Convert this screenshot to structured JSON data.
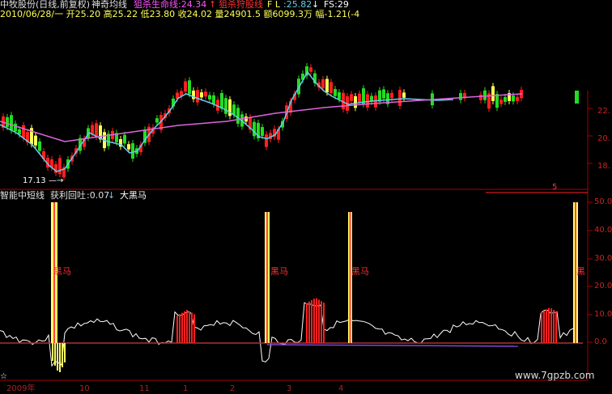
{
  "header": {
    "stock_name": "中牧股份(日线,前复权)",
    "indicator1_name": "神奇均线",
    "indicator1_label": "狙杀生命线",
    "indicator1_value": ":24.34",
    "indicator1_arrow": "↑",
    "indicator2_label": "狙杀狩股线",
    "indicator2_flag": "F L",
    "indicator2_value": ":25.82",
    "indicator2_arrow": "↓",
    "fs_label": "FS:29",
    "quote_line": "2010/06/28/一 开25.20 高25.22 低23.80 收24.02 量24901.5 额6099.3万 幅-1.21(-4"
  },
  "main_chart": {
    "low_annotation": "17.13",
    "y_ticks": [
      "22.",
      "20.",
      "18."
    ]
  },
  "sub_chart": {
    "title": "智能中短线",
    "metric_label": "获利回吐",
    "metric_value": ":0.07",
    "metric_arrow": "↓",
    "extra_label": "大黑马",
    "signal_labels": [
      "黑马",
      "黑马",
      "黑马",
      "黑"
    ],
    "y_ticks": [
      "50.0",
      "40.0",
      "30.0",
      "20.0",
      "10.0",
      "0.0"
    ],
    "marker_value": "5"
  },
  "x_axis": {
    "date_labels": [
      "2009年",
      "10",
      "11",
      "1",
      "2",
      "3",
      "4"
    ]
  },
  "watermark": "www.7gpzb.com",
  "colors": {
    "up": "#ff2020",
    "down": "#22dd22",
    "flat": "#ffff55",
    "signal_yellow": "#ffff66",
    "ma_cyan": "#66ccee",
    "ma_magenta": "#dd66dd",
    "axis_red": "#aa0000"
  }
}
